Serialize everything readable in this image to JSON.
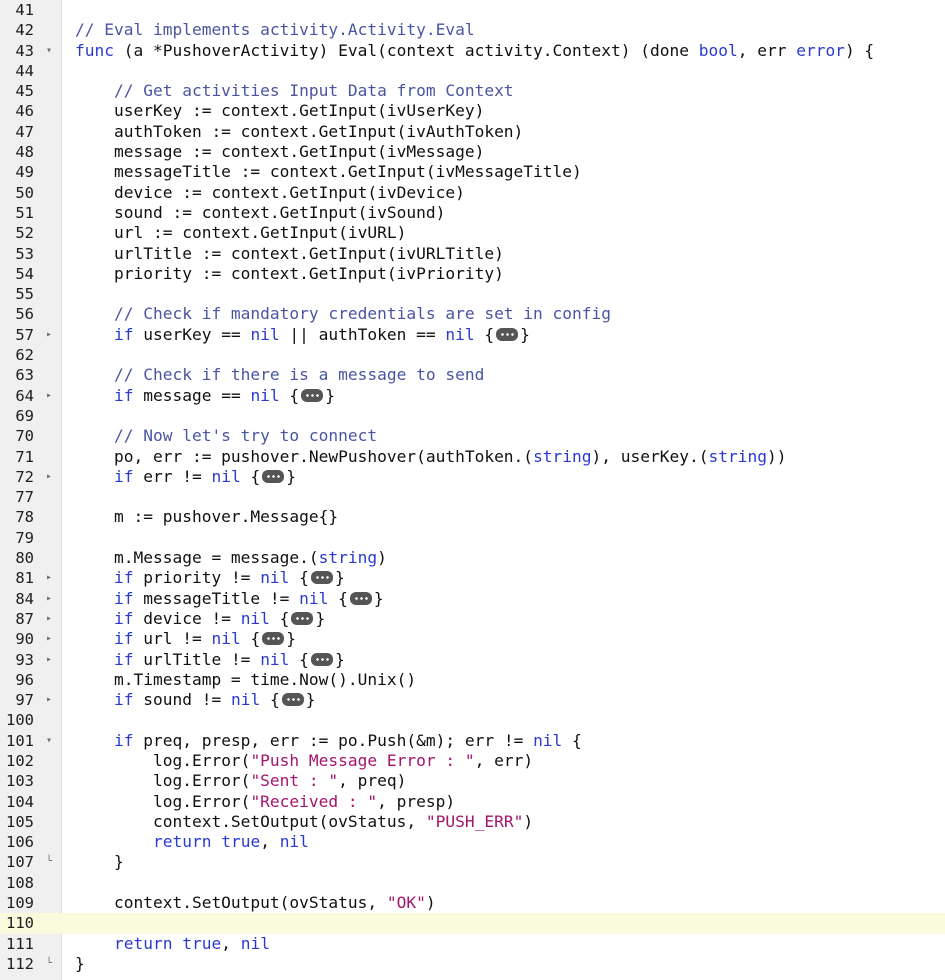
{
  "colors": {
    "comment": "#4a55a2",
    "keyword": "#2a3ad1",
    "string": "#a3146d",
    "text": "#101010",
    "active_line": "#fafadc",
    "gutter": "#f0f0f0"
  },
  "active_line": 110,
  "lines": [
    {
      "n": "41",
      "fold": "",
      "indent": 0,
      "tokens": []
    },
    {
      "n": "42",
      "fold": "",
      "indent": 0,
      "tokens": [
        {
          "t": "c",
          "v": "// Eval implements activity.Activity.Eval"
        }
      ]
    },
    {
      "n": "43",
      "fold": "down",
      "indent": 0,
      "tokens": [
        {
          "t": "k",
          "v": "func"
        },
        {
          "t": "p",
          "v": " (a *PushoverActivity) Eval(context activity.Context) (done "
        },
        {
          "t": "k",
          "v": "bool"
        },
        {
          "t": "p",
          "v": ", err "
        },
        {
          "t": "k",
          "v": "error"
        },
        {
          "t": "p",
          "v": ") {"
        }
      ]
    },
    {
      "n": "44",
      "fold": "",
      "indent": 0,
      "tokens": []
    },
    {
      "n": "45",
      "fold": "",
      "indent": 1,
      "tokens": [
        {
          "t": "c",
          "v": "// Get activities Input Data from Context"
        }
      ]
    },
    {
      "n": "46",
      "fold": "",
      "indent": 1,
      "tokens": [
        {
          "t": "p",
          "v": "userKey := context.GetInput(ivUserKey)"
        }
      ]
    },
    {
      "n": "47",
      "fold": "",
      "indent": 1,
      "tokens": [
        {
          "t": "p",
          "v": "authToken := context.GetInput(ivAuthToken)"
        }
      ]
    },
    {
      "n": "48",
      "fold": "",
      "indent": 1,
      "tokens": [
        {
          "t": "p",
          "v": "message := context.GetInput(ivMessage)"
        }
      ]
    },
    {
      "n": "49",
      "fold": "",
      "indent": 1,
      "tokens": [
        {
          "t": "p",
          "v": "messageTitle := context.GetInput(ivMessageTitle)"
        }
      ]
    },
    {
      "n": "50",
      "fold": "",
      "indent": 1,
      "tokens": [
        {
          "t": "p",
          "v": "device := context.GetInput(ivDevice)"
        }
      ]
    },
    {
      "n": "51",
      "fold": "",
      "indent": 1,
      "tokens": [
        {
          "t": "p",
          "v": "sound := context.GetInput(ivSound)"
        }
      ]
    },
    {
      "n": "52",
      "fold": "",
      "indent": 1,
      "tokens": [
        {
          "t": "p",
          "v": "url := context.GetInput(ivURL)"
        }
      ]
    },
    {
      "n": "53",
      "fold": "",
      "indent": 1,
      "tokens": [
        {
          "t": "p",
          "v": "urlTitle := context.GetInput(ivURLTitle)"
        }
      ]
    },
    {
      "n": "54",
      "fold": "",
      "indent": 1,
      "tokens": [
        {
          "t": "p",
          "v": "priority := context.GetInput(ivPriority)"
        }
      ]
    },
    {
      "n": "55",
      "fold": "",
      "indent": 0,
      "tokens": []
    },
    {
      "n": "56",
      "fold": "",
      "indent": 1,
      "tokens": [
        {
          "t": "c",
          "v": "// Check if mandatory credentials are set in config"
        }
      ]
    },
    {
      "n": "57",
      "fold": "right",
      "indent": 1,
      "tokens": [
        {
          "t": "k",
          "v": "if"
        },
        {
          "t": "p",
          "v": " userKey == "
        },
        {
          "t": "k",
          "v": "nil"
        },
        {
          "t": "p",
          "v": " || authToken == "
        },
        {
          "t": "k",
          "v": "nil"
        },
        {
          "t": "p",
          "v": " {"
        },
        {
          "t": "x"
        },
        {
          "t": "p",
          "v": "}"
        }
      ]
    },
    {
      "n": "62",
      "fold": "",
      "indent": 0,
      "tokens": []
    },
    {
      "n": "63",
      "fold": "",
      "indent": 1,
      "tokens": [
        {
          "t": "c",
          "v": "// Check if there is a message to send"
        }
      ]
    },
    {
      "n": "64",
      "fold": "right",
      "indent": 1,
      "tokens": [
        {
          "t": "k",
          "v": "if"
        },
        {
          "t": "p",
          "v": " message == "
        },
        {
          "t": "k",
          "v": "nil"
        },
        {
          "t": "p",
          "v": " {"
        },
        {
          "t": "x"
        },
        {
          "t": "p",
          "v": "}"
        }
      ]
    },
    {
      "n": "69",
      "fold": "",
      "indent": 0,
      "tokens": []
    },
    {
      "n": "70",
      "fold": "",
      "indent": 1,
      "tokens": [
        {
          "t": "c",
          "v": "// Now let's try to connect"
        }
      ]
    },
    {
      "n": "71",
      "fold": "",
      "indent": 1,
      "tokens": [
        {
          "t": "p",
          "v": "po, err := pushover.NewPushover(authToken.("
        },
        {
          "t": "k",
          "v": "string"
        },
        {
          "t": "p",
          "v": "), userKey.("
        },
        {
          "t": "k",
          "v": "string"
        },
        {
          "t": "p",
          "v": "))"
        }
      ]
    },
    {
      "n": "72",
      "fold": "right",
      "indent": 1,
      "tokens": [
        {
          "t": "k",
          "v": "if"
        },
        {
          "t": "p",
          "v": " err != "
        },
        {
          "t": "k",
          "v": "nil"
        },
        {
          "t": "p",
          "v": " {"
        },
        {
          "t": "x"
        },
        {
          "t": "p",
          "v": "}"
        }
      ]
    },
    {
      "n": "77",
      "fold": "",
      "indent": 0,
      "tokens": []
    },
    {
      "n": "78",
      "fold": "",
      "indent": 1,
      "tokens": [
        {
          "t": "p",
          "v": "m := pushover.Message{}"
        }
      ]
    },
    {
      "n": "79",
      "fold": "",
      "indent": 0,
      "tokens": []
    },
    {
      "n": "80",
      "fold": "",
      "indent": 1,
      "tokens": [
        {
          "t": "p",
          "v": "m.Message = message.("
        },
        {
          "t": "k",
          "v": "string"
        },
        {
          "t": "p",
          "v": ")"
        }
      ]
    },
    {
      "n": "81",
      "fold": "right",
      "indent": 1,
      "tokens": [
        {
          "t": "k",
          "v": "if"
        },
        {
          "t": "p",
          "v": " priority != "
        },
        {
          "t": "k",
          "v": "nil"
        },
        {
          "t": "p",
          "v": " {"
        },
        {
          "t": "x"
        },
        {
          "t": "p",
          "v": "}"
        }
      ]
    },
    {
      "n": "84",
      "fold": "right",
      "indent": 1,
      "tokens": [
        {
          "t": "k",
          "v": "if"
        },
        {
          "t": "p",
          "v": " messageTitle != "
        },
        {
          "t": "k",
          "v": "nil"
        },
        {
          "t": "p",
          "v": " {"
        },
        {
          "t": "x"
        },
        {
          "t": "p",
          "v": "}"
        }
      ]
    },
    {
      "n": "87",
      "fold": "right",
      "indent": 1,
      "tokens": [
        {
          "t": "k",
          "v": "if"
        },
        {
          "t": "p",
          "v": " device != "
        },
        {
          "t": "k",
          "v": "nil"
        },
        {
          "t": "p",
          "v": " {"
        },
        {
          "t": "x"
        },
        {
          "t": "p",
          "v": "}"
        }
      ]
    },
    {
      "n": "90",
      "fold": "right",
      "indent": 1,
      "tokens": [
        {
          "t": "k",
          "v": "if"
        },
        {
          "t": "p",
          "v": " url != "
        },
        {
          "t": "k",
          "v": "nil"
        },
        {
          "t": "p",
          "v": " {"
        },
        {
          "t": "x"
        },
        {
          "t": "p",
          "v": "}"
        }
      ]
    },
    {
      "n": "93",
      "fold": "right",
      "indent": 1,
      "tokens": [
        {
          "t": "k",
          "v": "if"
        },
        {
          "t": "p",
          "v": " urlTitle != "
        },
        {
          "t": "k",
          "v": "nil"
        },
        {
          "t": "p",
          "v": " {"
        },
        {
          "t": "x"
        },
        {
          "t": "p",
          "v": "}"
        }
      ]
    },
    {
      "n": "96",
      "fold": "",
      "indent": 1,
      "tokens": [
        {
          "t": "p",
          "v": "m.Timestamp = time.Now().Unix()"
        }
      ]
    },
    {
      "n": "97",
      "fold": "right",
      "indent": 1,
      "tokens": [
        {
          "t": "k",
          "v": "if"
        },
        {
          "t": "p",
          "v": " sound != "
        },
        {
          "t": "k",
          "v": "nil"
        },
        {
          "t": "p",
          "v": " {"
        },
        {
          "t": "x"
        },
        {
          "t": "p",
          "v": "}"
        }
      ]
    },
    {
      "n": "100",
      "fold": "",
      "indent": 0,
      "tokens": []
    },
    {
      "n": "101",
      "fold": "down",
      "indent": 1,
      "tokens": [
        {
          "t": "k",
          "v": "if"
        },
        {
          "t": "p",
          "v": " preq, presp, err := po.Push(&m); err != "
        },
        {
          "t": "k",
          "v": "nil"
        },
        {
          "t": "p",
          "v": " {"
        }
      ]
    },
    {
      "n": "102",
      "fold": "",
      "indent": 2,
      "tokens": [
        {
          "t": "p",
          "v": "log.Error("
        },
        {
          "t": "s",
          "v": "\"Push Message Error : \""
        },
        {
          "t": "p",
          "v": ", err)"
        }
      ]
    },
    {
      "n": "103",
      "fold": "",
      "indent": 2,
      "tokens": [
        {
          "t": "p",
          "v": "log.Error("
        },
        {
          "t": "s",
          "v": "\"Sent : \""
        },
        {
          "t": "p",
          "v": ", preq)"
        }
      ]
    },
    {
      "n": "104",
      "fold": "",
      "indent": 2,
      "tokens": [
        {
          "t": "p",
          "v": "log.Error("
        },
        {
          "t": "s",
          "v": "\"Received : \""
        },
        {
          "t": "p",
          "v": ", presp)"
        }
      ]
    },
    {
      "n": "105",
      "fold": "",
      "indent": 2,
      "tokens": [
        {
          "t": "p",
          "v": "context.SetOutput(ovStatus, "
        },
        {
          "t": "s",
          "v": "\"PUSH_ERR\""
        },
        {
          "t": "p",
          "v": ")"
        }
      ]
    },
    {
      "n": "106",
      "fold": "",
      "indent": 2,
      "tokens": [
        {
          "t": "k",
          "v": "return"
        },
        {
          "t": "p",
          "v": " "
        },
        {
          "t": "k",
          "v": "true"
        },
        {
          "t": "p",
          "v": ", "
        },
        {
          "t": "k",
          "v": "nil"
        }
      ]
    },
    {
      "n": "107",
      "fold": "end",
      "indent": 1,
      "tokens": [
        {
          "t": "p",
          "v": "}"
        }
      ]
    },
    {
      "n": "108",
      "fold": "",
      "indent": 0,
      "tokens": []
    },
    {
      "n": "109",
      "fold": "",
      "indent": 1,
      "tokens": [
        {
          "t": "p",
          "v": "context.SetOutput(ovStatus, "
        },
        {
          "t": "s",
          "v": "\"OK\""
        },
        {
          "t": "p",
          "v": ")"
        }
      ]
    },
    {
      "n": "110",
      "fold": "",
      "indent": 0,
      "tokens": []
    },
    {
      "n": "111",
      "fold": "",
      "indent": 1,
      "tokens": [
        {
          "t": "k",
          "v": "return"
        },
        {
          "t": "p",
          "v": " "
        },
        {
          "t": "k",
          "v": "true"
        },
        {
          "t": "p",
          "v": ", "
        },
        {
          "t": "k",
          "v": "nil"
        }
      ]
    },
    {
      "n": "112",
      "fold": "end",
      "indent": 0,
      "tokens": [
        {
          "t": "p",
          "v": "}"
        }
      ]
    }
  ]
}
